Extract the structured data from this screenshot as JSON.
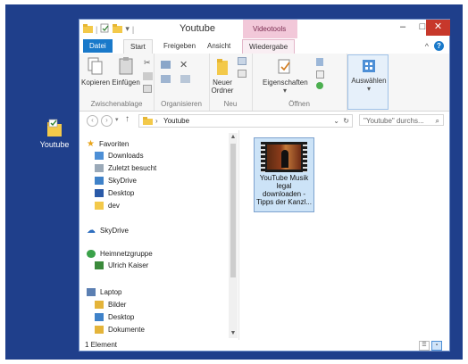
{
  "desktop": {
    "icon_label": "Youtube",
    "icon": "folder-icon"
  },
  "window": {
    "title": "Youtube",
    "context_group": "Videotools",
    "controls": {
      "minimize": "–",
      "maximize": "□",
      "close": "✕"
    }
  },
  "tabs": {
    "file": "Datei",
    "start": "Start",
    "share": "Freigeben",
    "view": "Ansicht",
    "playback": "Wiedergabe"
  },
  "ribbon": {
    "copy": "Kopieren",
    "paste": "Einfügen",
    "group_clipboard": "Zwischenablage",
    "group_organize": "Organisieren",
    "new_folder_line1": "Neuer",
    "new_folder_line2": "Ordner",
    "group_new": "Neu",
    "properties": "Eigenschaften",
    "group_open": "Öffnen",
    "select_all": "Auswählen"
  },
  "address": {
    "crumb": "Youtube",
    "search_placeholder": "\"Youtube\" durchs..."
  },
  "nav": {
    "favorites": "Favoriten",
    "downloads": "Downloads",
    "recent": "Zuletzt besucht",
    "skydrive_fav": "SkyDrive",
    "desktop_fav": "Desktop",
    "dev": "dev",
    "skydrive": "SkyDrive",
    "homegroup": "Heimnetzgruppe",
    "user": "Ulrich Kaiser",
    "laptop": "Laptop",
    "pictures": "Bilder",
    "desktop": "Desktop",
    "documents": "Dokumente"
  },
  "content": {
    "file_name": "YouTube Musik legal downloaden - Tipps der Kanzl..."
  },
  "status": {
    "count": "1 Element"
  },
  "colors": {
    "accent": "#1979ca",
    "context": "#f2c8d9",
    "desktop": "#1f3f8b",
    "close": "#c7382b"
  }
}
